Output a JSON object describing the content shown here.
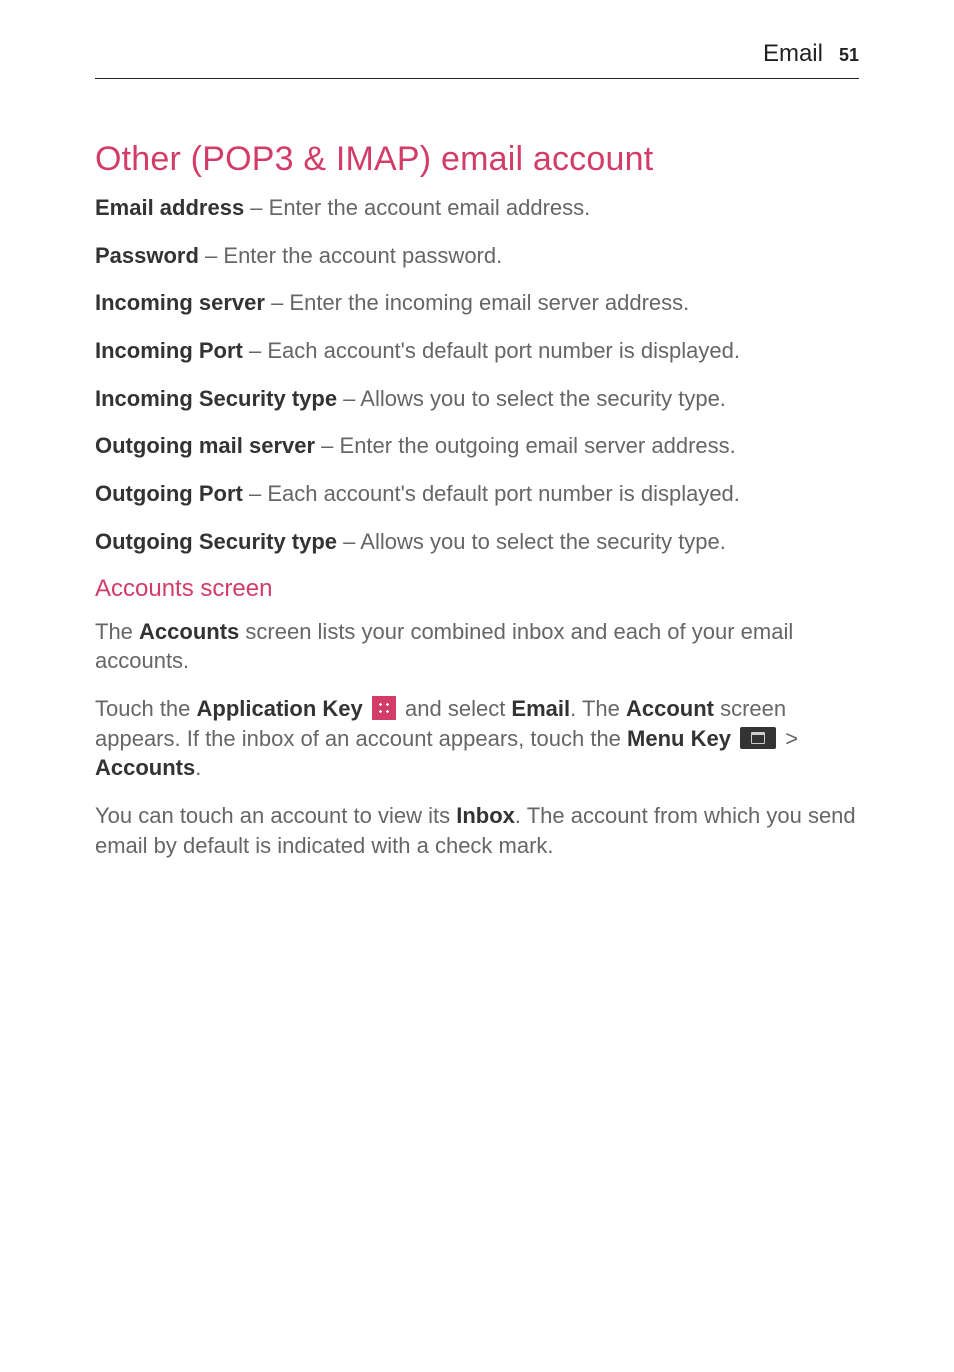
{
  "header": {
    "section_label": "Email",
    "page_number": "51"
  },
  "section": {
    "title": "Other (POP3 & IMAP) email account"
  },
  "fields": {
    "email_address_label": "Email address",
    "email_address_desc": " – Enter the account email address.",
    "password_label": "Password",
    "password_desc": " – Enter the account password.",
    "incoming_server_label": "Incoming server",
    "incoming_server_desc": " – Enter the incoming email server address.",
    "incoming_port_label": "Incoming Port",
    "incoming_port_desc": " – Each account's default port number is displayed.",
    "incoming_security_label": "Incoming Security type",
    "incoming_security_desc": " – Allows you to select the security type.",
    "outgoing_server_label": "Outgoing mail server",
    "outgoing_server_desc": " – Enter the outgoing email server address.",
    "outgoing_port_label": "Outgoing Port",
    "outgoing_port_desc": " – Each account's default port number is displayed.",
    "outgoing_security_label": "Outgoing Security type",
    "outgoing_security_desc": " – Allows you to select the security type."
  },
  "accounts_section": {
    "title": "Accounts screen",
    "para1_pre": "The ",
    "para1_bold": "Accounts",
    "para1_post": " screen lists your combined inbox and each of your email accounts.",
    "para2_t1": "Touch the ",
    "para2_appkey": "Application Key",
    "para2_t2": " and select ",
    "para2_email": "Email",
    "para2_t3": ". The ",
    "para2_account": "Account",
    "para2_t4": " screen appears. If the inbox of an account appears, touch the ",
    "para2_menukey": "Menu Key",
    "para2_gt": " > ",
    "para2_accounts": "Accounts",
    "para2_period": ".",
    "para3_t1": "You can touch an account to view its ",
    "para3_inbox": "Inbox",
    "para3_t2": ". The account from which you send email by default is indicated with a check mark."
  }
}
